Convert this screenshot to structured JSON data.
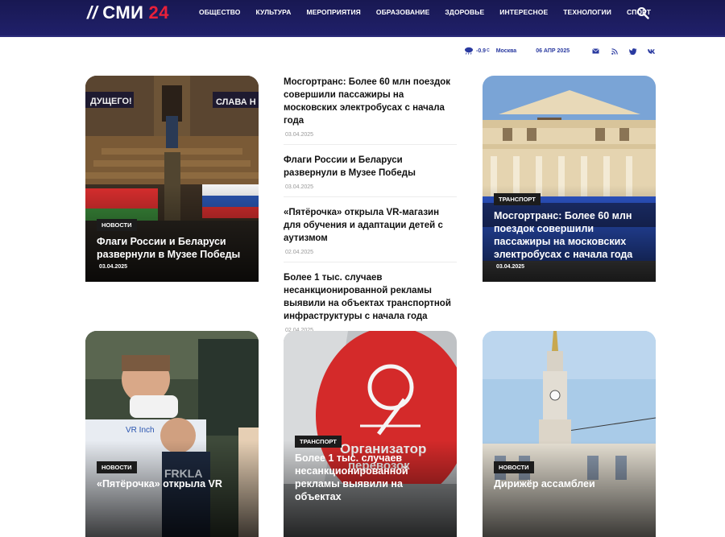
{
  "header": {
    "logo_slashes": "//",
    "logo_text": "СМИ",
    "logo_num": "24",
    "nav": [
      {
        "label": "ОБЩЕСТВО"
      },
      {
        "label": "КУЛЬТУРА"
      },
      {
        "label": "МЕРОПРИЯТИЯ"
      },
      {
        "label": "ОБРАЗОВАНИЕ"
      },
      {
        "label": "ЗДОРОВЬЕ"
      },
      {
        "label": "ИНТЕРЕСНОЕ"
      },
      {
        "label": "ТЕХНОЛОГИИ"
      },
      {
        "label": "СПОРТ"
      }
    ],
    "search_icon": "search-icon"
  },
  "info": {
    "temperature": "-0.9",
    "unit": "C",
    "city": "Москва",
    "date": "06 АПР 2025",
    "socials": [
      "mail-icon",
      "rss-icon",
      "twitter-icon",
      "vk-icon"
    ]
  },
  "cards": {
    "c1": {
      "badge": "НОВОСТИ",
      "title": "Флаги России и Беларуси развернули в Музее Победы",
      "date": "03.04.2025"
    },
    "c2": {
      "badge": "ТРАНСПОРТ",
      "title": "Мосгортранс: Более 60 млн поездок совершили пассажиры на московских электробусах с начала года",
      "date": "03.04.2025"
    },
    "c3": {
      "badge": "НОВОСТИ",
      "title": "«Пятёрочка» открыла VR",
      "date": ""
    },
    "c4": {
      "badge": "ТРАНСПОРТ",
      "title": "Более 1 тыс. случаев несанкционированной рекламы выявили на объектах",
      "date": ""
    },
    "c5": {
      "badge": "НОВОСТИ",
      "title": "Дирижёр ассамблеи",
      "date": ""
    }
  },
  "list": [
    {
      "title": "Мосгортранс: Более 60 млн поездок совершили пассажиры на московских электробусах с начала года",
      "date": "03.04.2025"
    },
    {
      "title": "Флаги России и Беларуси развернули в Музее Победы",
      "date": "03.04.2025"
    },
    {
      "title": "«Пятёрочка» открыла VR-магазин для обучения и адаптации детей с аутизмом",
      "date": "02.04.2025"
    },
    {
      "title": "Более 1 тыс. случаев несанкционированной рекламы выявили на объектах транспортной инфраструктуры с начала года",
      "date": "02.04.2025"
    }
  ],
  "colors": {
    "header": "#1a1a5e",
    "accent": "#e8213a",
    "link": "#2a3aa0"
  }
}
